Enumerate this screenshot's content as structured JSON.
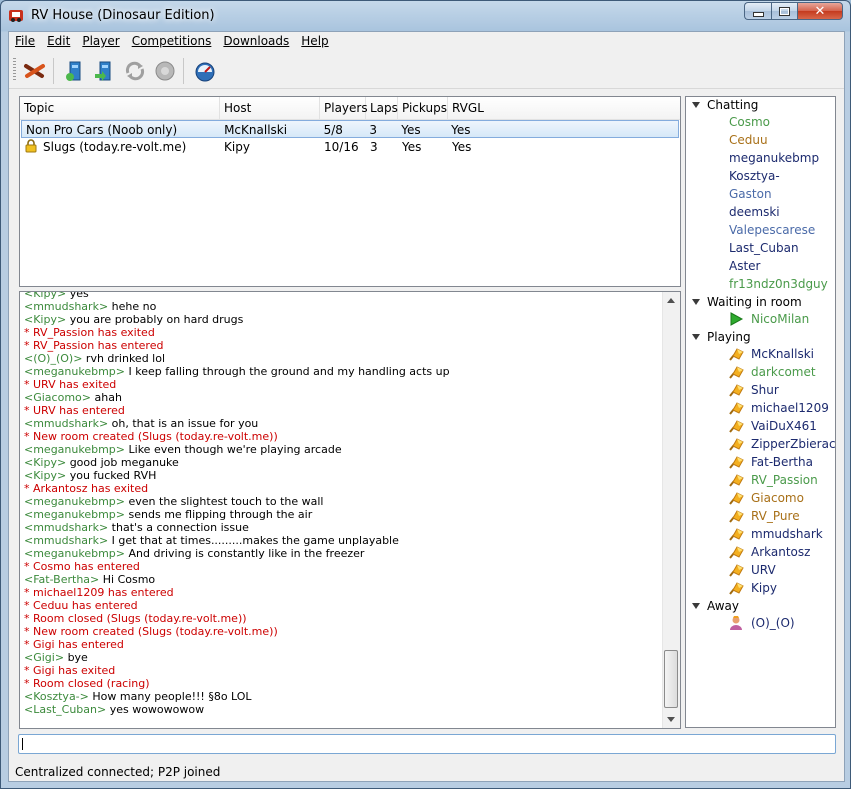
{
  "window": {
    "title": "RV House (Dinosaur Edition)"
  },
  "menu": [
    "File",
    "Edit",
    "Player",
    "Competitions",
    "Downloads",
    "Help"
  ],
  "rooms": {
    "columns": [
      "Topic",
      "Host",
      "Players",
      "Laps",
      "Pickups",
      "RVGL"
    ],
    "rows": [
      {
        "topic": "Non Pro Cars (Noob only)",
        "host": "McKnallski",
        "players": "5/8",
        "laps": "3",
        "pickups": "Yes",
        "rvgl": "Yes",
        "locked": false,
        "selected": true
      },
      {
        "topic": "Slugs (today.re-volt.me)",
        "host": "Kipy",
        "players": "10/16",
        "laps": "3",
        "pickups": "Yes",
        "rvgl": "Yes",
        "locked": true,
        "selected": false
      }
    ]
  },
  "chat": [
    {
      "type": "msg",
      "nick": "Kipy",
      "text": "yes"
    },
    {
      "type": "msg",
      "nick": "mmudshark",
      "text": "hehe  no"
    },
    {
      "type": "msg",
      "nick": "Kipy",
      "text": "you are probably on hard drugs"
    },
    {
      "type": "sys",
      "text": "* RV_Passion has exited"
    },
    {
      "type": "sys",
      "text": "* RV_Passion has entered"
    },
    {
      "type": "msg",
      "nick": "(O)_(O)",
      "text": "rvh drinked lol"
    },
    {
      "type": "msg",
      "nick": "meganukebmp",
      "text": "I keep falling through the ground and my handling acts up"
    },
    {
      "type": "sys",
      "text": "* URV has exited"
    },
    {
      "type": "msg",
      "nick": "Giacomo",
      "text": "ahah"
    },
    {
      "type": "sys",
      "text": "* URV has entered"
    },
    {
      "type": "msg",
      "nick": "mmudshark",
      "text": "oh, that is an issue for you"
    },
    {
      "type": "sys",
      "text": "* New room created (Slugs (today.re-volt.me))"
    },
    {
      "type": "msg",
      "nick": "meganukebmp",
      "text": "Like even though we're playing arcade"
    },
    {
      "type": "msg",
      "nick": "Kipy",
      "text": "good job meganuke"
    },
    {
      "type": "msg",
      "nick": "Kipy",
      "text": "you fucked RVH"
    },
    {
      "type": "sys",
      "text": "* Arkantosz has exited"
    },
    {
      "type": "msg",
      "nick": "meganukebmp",
      "text": "even the slightest touch to the wall"
    },
    {
      "type": "msg",
      "nick": "meganukebmp",
      "text": "sends me flipping through the air"
    },
    {
      "type": "msg",
      "nick": "mmudshark",
      "text": "that's a connection issue"
    },
    {
      "type": "msg",
      "nick": "mmudshark",
      "text": "I get that at times.........makes the game unplayable"
    },
    {
      "type": "msg",
      "nick": "meganukebmp",
      "text": "And driving is constantly like in the freezer"
    },
    {
      "type": "sys",
      "text": "* Cosmo has entered"
    },
    {
      "type": "msg",
      "nick": "Fat-Bertha",
      "text": "Hi Cosmo"
    },
    {
      "type": "sys",
      "text": "* michael1209 has entered"
    },
    {
      "type": "sys",
      "text": "* Ceduu has entered"
    },
    {
      "type": "sys",
      "text": "* Room closed (Slugs (today.re-volt.me))"
    },
    {
      "type": "sys",
      "text": "* New room created (Slugs (today.re-volt.me))"
    },
    {
      "type": "sys",
      "text": "* Gigi has entered"
    },
    {
      "type": "msg",
      "nick": "Gigi",
      "text": "bye"
    },
    {
      "type": "sys",
      "text": "* Gigi has exited"
    },
    {
      "type": "sys",
      "text": "* Room closed (racing)"
    },
    {
      "type": "msg",
      "nick": "Kosztya-",
      "text": "How many people!!! §8o LOL"
    },
    {
      "type": "msg",
      "nick": "Last_Cuban",
      "text": "yes wowowowow"
    }
  ],
  "users": {
    "chatting": {
      "label": "Chatting",
      "names": [
        {
          "name": "Cosmo",
          "color": "#4a9a4a"
        },
        {
          "name": "Ceduu",
          "color": "#a87018"
        },
        {
          "name": "meganukebmp",
          "color": "#1c2a6e"
        },
        {
          "name": "Kosztya-",
          "color": "#1c2a6e"
        },
        {
          "name": "Gaston",
          "color": "#4a6aa8"
        },
        {
          "name": "deemski",
          "color": "#1c2a6e"
        },
        {
          "name": "Valepescarese",
          "color": "#4a6aa8"
        },
        {
          "name": "Last_Cuban",
          "color": "#1c2a6e"
        },
        {
          "name": "Aster",
          "color": "#1c2a6e"
        },
        {
          "name": "fr13ndz0n3dguy",
          "color": "#4a9a4a"
        }
      ]
    },
    "waiting": {
      "label": "Waiting in room",
      "names": [
        {
          "name": "NicoMilan",
          "color": "#4a9a4a"
        }
      ]
    },
    "playing": {
      "label": "Playing",
      "names": [
        {
          "name": "McKnallski",
          "color": "#1c2a6e"
        },
        {
          "name": "darkcomet",
          "color": "#4a9a4a"
        },
        {
          "name": "Shur",
          "color": "#1c2a6e"
        },
        {
          "name": "michael1209",
          "color": "#1c2a6e"
        },
        {
          "name": "VaiDuX461",
          "color": "#1c2a6e"
        },
        {
          "name": "ZipperZbieracz",
          "color": "#1c2a6e"
        },
        {
          "name": "Fat-Bertha",
          "color": "#1c2a6e"
        },
        {
          "name": "RV_Passion",
          "color": "#4a9a4a"
        },
        {
          "name": "Giacomo",
          "color": "#a87018"
        },
        {
          "name": "RV_Pure",
          "color": "#a87018"
        },
        {
          "name": "mmudshark",
          "color": "#1c2a6e"
        },
        {
          "name": "Arkantosz",
          "color": "#1c2a6e"
        },
        {
          "name": "URV",
          "color": "#1c2a6e"
        },
        {
          "name": "Kipy",
          "color": "#1c2a6e"
        }
      ]
    },
    "away": {
      "label": "Away",
      "names": [
        {
          "name": "(O)_(O)",
          "color": "#1c2a6e"
        }
      ]
    }
  },
  "input": {
    "value": ""
  },
  "status": "Centralized connected; P2P joined"
}
